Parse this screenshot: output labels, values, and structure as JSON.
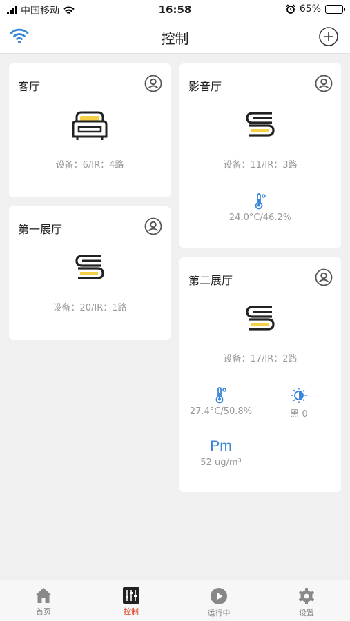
{
  "status_bar": {
    "carrier": "中国移动",
    "time": "16:58",
    "battery": "65%",
    "battery_level": 0.65
  },
  "nav": {
    "title": "控制"
  },
  "colors": {
    "accent": "#3a86d8",
    "active_tab": "#e23b1d",
    "icon_yellow": "#f5cf45"
  },
  "rooms": [
    {
      "name": "客厅",
      "icon": "sofa-icon",
      "devices": "设备：6/IR：4路"
    },
    {
      "name": "第一展厅",
      "icon": "books-icon",
      "devices": "设备：20/IR：1路"
    },
    {
      "name": "影音厅",
      "icon": "books-icon",
      "devices": "设备：11/IR：3路",
      "sensors": [
        {
          "icon": "thermometer-icon",
          "value": "24.0°C/46.2%"
        }
      ]
    },
    {
      "name": "第二展厅",
      "icon": "books-icon",
      "devices": "设备：17/IR：2路",
      "sensors": [
        {
          "icon": "thermometer-icon",
          "value": "27.4°C/50.8%"
        },
        {
          "icon": "brightness-icon",
          "value": "黑   0"
        },
        {
          "icon": "pm-icon",
          "label": "Pm",
          "value": "52 ug/m³"
        }
      ]
    }
  ],
  "tabs": [
    {
      "label": "首页",
      "icon": "home-icon",
      "active": false
    },
    {
      "label": "控制",
      "icon": "sliders-icon",
      "active": true
    },
    {
      "label": "运行中",
      "icon": "play-icon",
      "active": false
    },
    {
      "label": "设置",
      "icon": "gear-icon",
      "active": false
    }
  ]
}
